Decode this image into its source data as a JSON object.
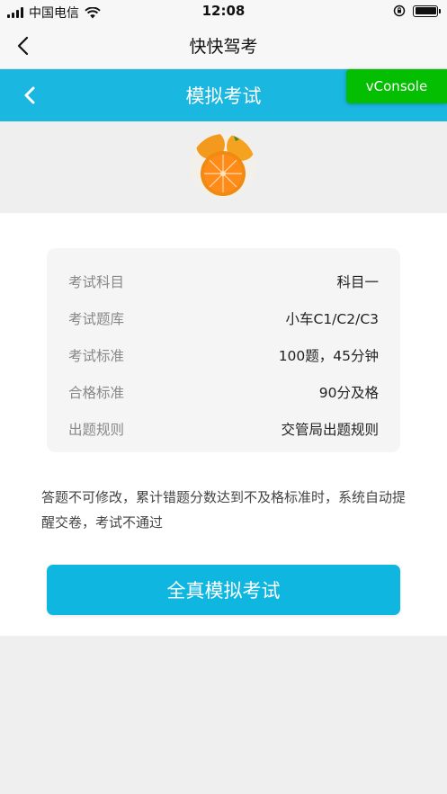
{
  "status_bar": {
    "carrier": "中国电信",
    "time": "12:08"
  },
  "nav": {
    "title": "快快驾考"
  },
  "header": {
    "title": "模拟考试",
    "accent_color": "#1ab7e0"
  },
  "vconsole": {
    "label": "vConsole",
    "color": "#04be02"
  },
  "avatar": {
    "icon": "orange-avatar"
  },
  "exam_info": [
    {
      "label": "考试科目",
      "value": "科目一"
    },
    {
      "label": "考试题库",
      "value": "小车C1/C2/C3"
    },
    {
      "label": "考试标准",
      "value": "100题，45分钟"
    },
    {
      "label": "合格标准",
      "value": "90分及格"
    },
    {
      "label": "出题规则",
      "value": "交管局出题规则"
    }
  ],
  "notice": "答题不可修改，累计错题分数达到不及格标准时，系统自动提醒交卷，考试不通过",
  "start_button": {
    "label": "全真模拟考试",
    "color": "#0fb6df"
  }
}
